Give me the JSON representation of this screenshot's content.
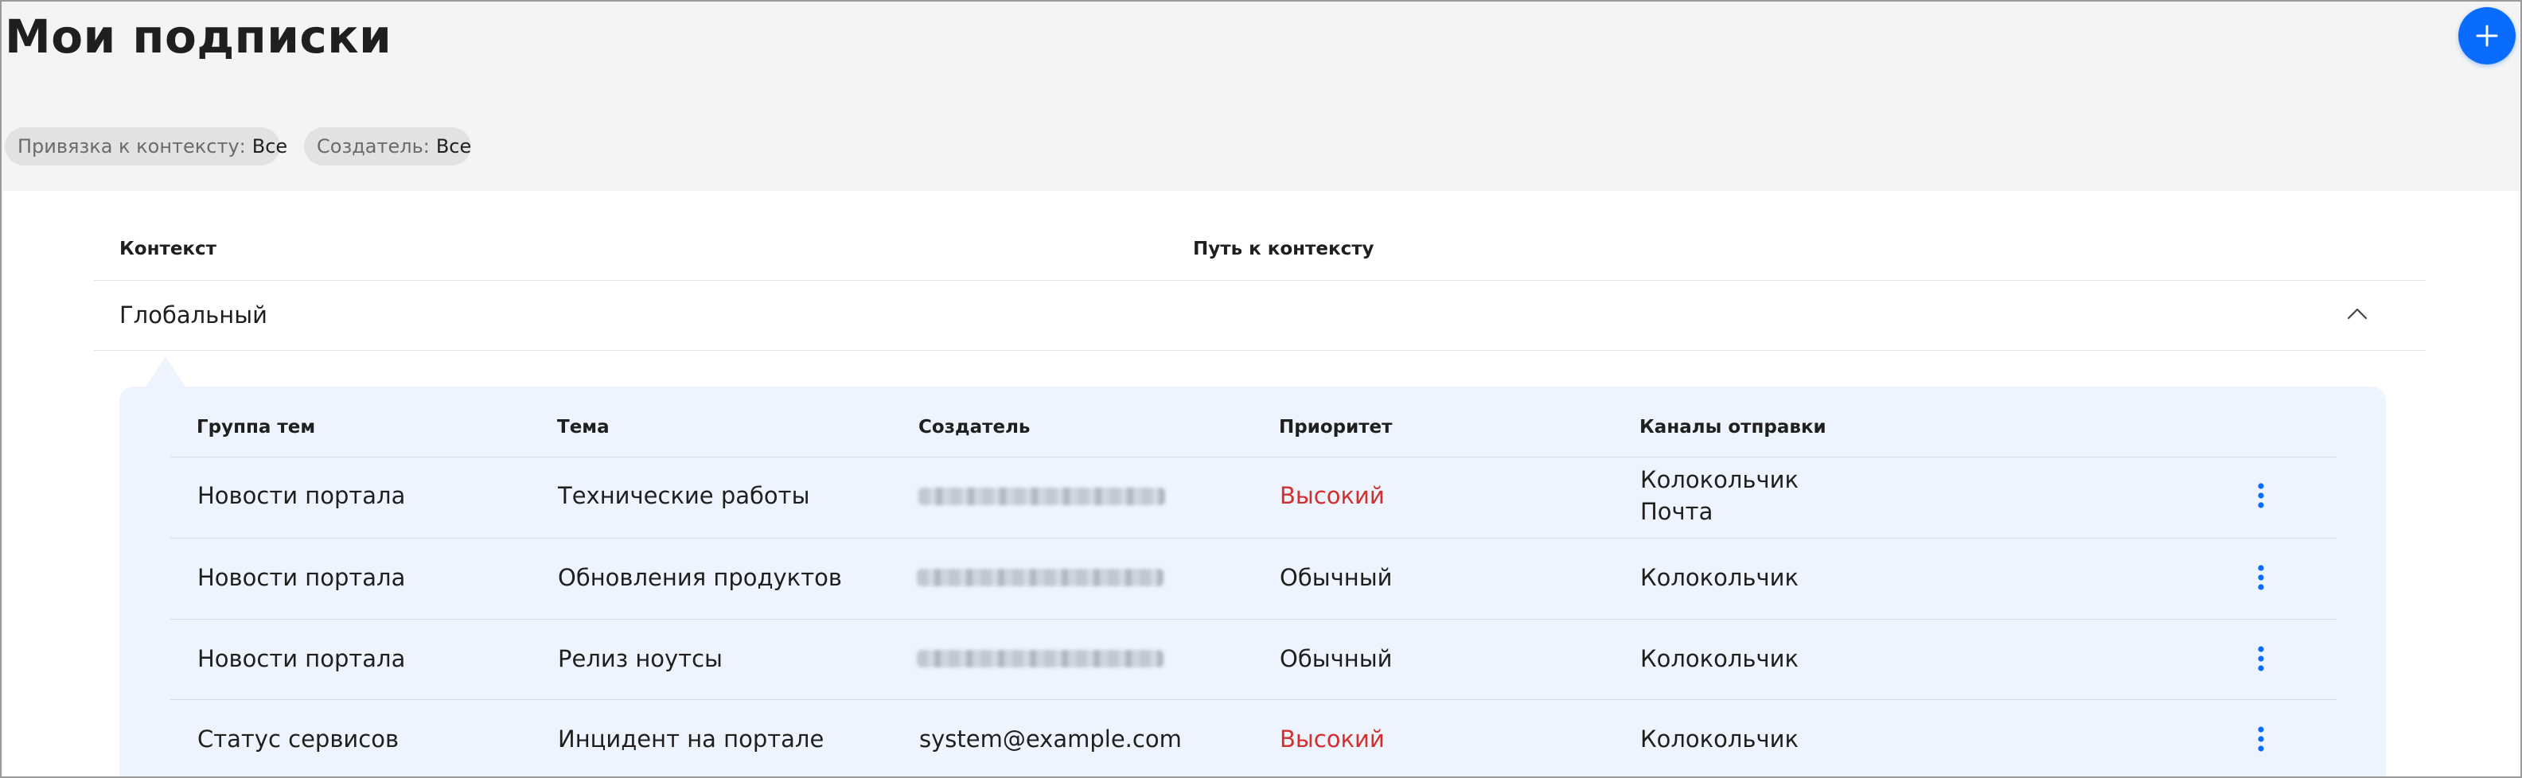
{
  "page": {
    "title": "Мои подписки"
  },
  "colors": {
    "accent": "#0a6cff",
    "priority_high": "#d32f2f",
    "panel_bg": "#eef4fd"
  },
  "filters": [
    {
      "label": "Привязка к контексту:",
      "value": "Все"
    },
    {
      "label": "Создатель:",
      "value": "Все"
    }
  ],
  "contexts_table": {
    "headers": {
      "context": "Контекст",
      "path": "Путь к контексту"
    },
    "group": {
      "name": "Глобальный",
      "expanded": true
    }
  },
  "subscriptions": {
    "headers": {
      "group": "Группа тем",
      "topic": "Тема",
      "creator": "Создатель",
      "priority": "Приоритет",
      "channels": "Каналы отправки"
    },
    "rows": [
      {
        "group": "Новости портала",
        "topic": "Технические работы",
        "creator": "",
        "creator_redacted": true,
        "priority": "Высокий",
        "priority_level": "high",
        "channels": [
          "Колокольчик",
          "Почта"
        ]
      },
      {
        "group": "Новости портала",
        "topic": "Обновления продуктов",
        "creator": "",
        "creator_redacted": true,
        "priority": "Обычный",
        "priority_level": "normal",
        "channels": [
          "Колокольчик"
        ]
      },
      {
        "group": "Новости портала",
        "topic": "Релиз ноутсы",
        "creator": "",
        "creator_redacted": true,
        "priority": "Обычный",
        "priority_level": "normal",
        "channels": [
          "Колокольчик"
        ]
      },
      {
        "group": "Статус сервисов",
        "topic": "Инцидент на портале",
        "creator": "system@example.com",
        "creator_redacted": false,
        "priority": "Высокий",
        "priority_level": "high",
        "channels": [
          "Колокольчик"
        ]
      }
    ]
  },
  "icons": {
    "add": "plus-icon",
    "collapse": "chevron-up-icon",
    "row_menu": "kebab-menu-icon"
  }
}
